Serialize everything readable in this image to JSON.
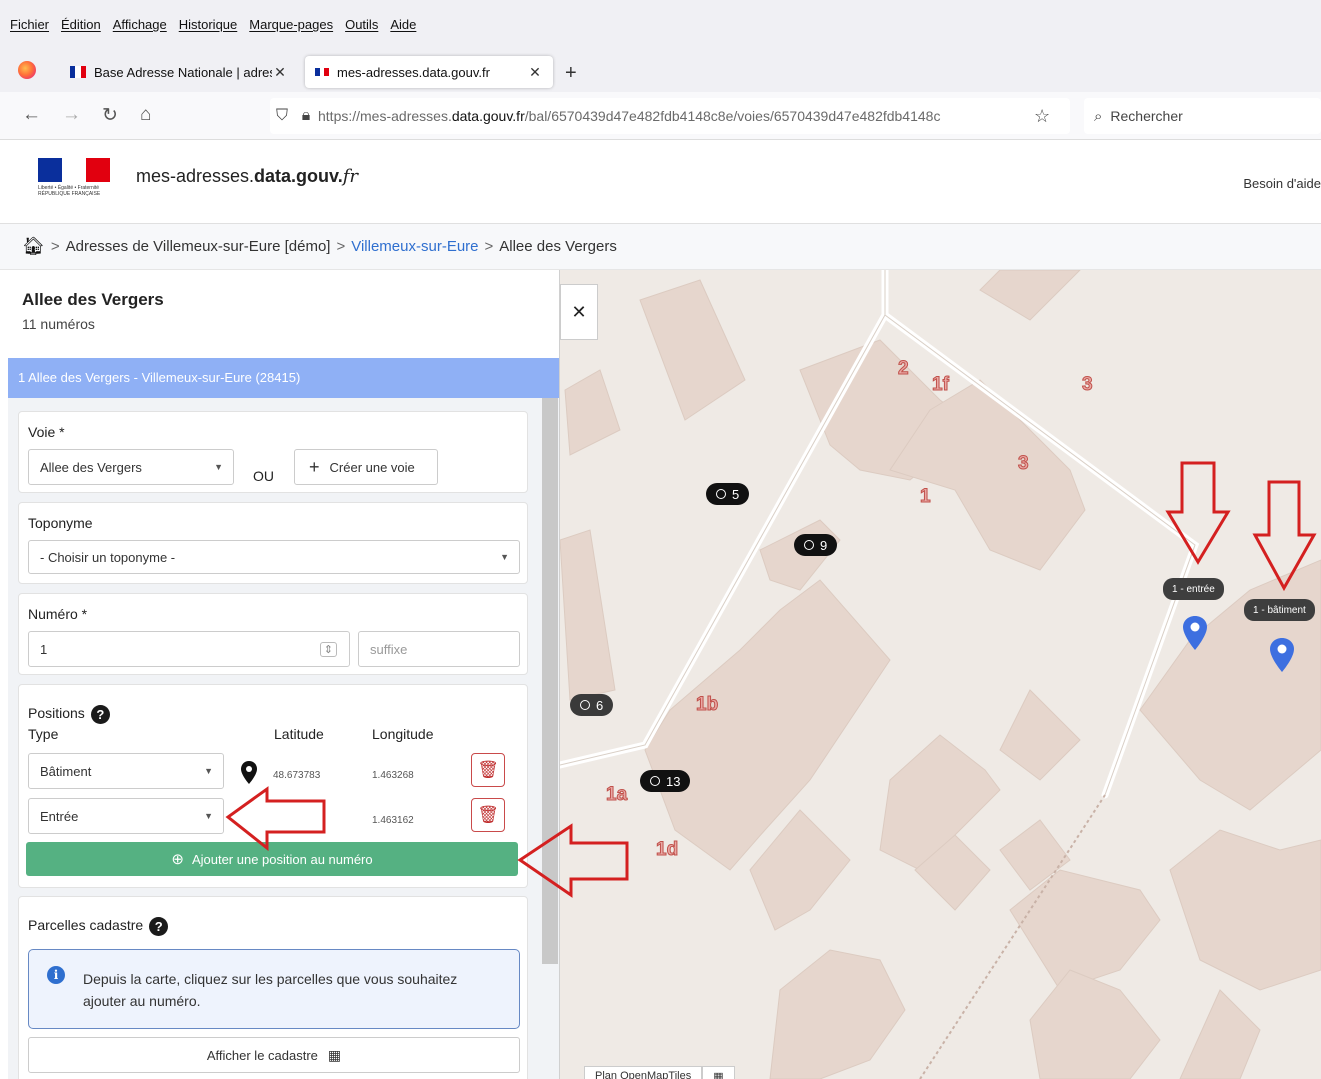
{
  "browser": {
    "menu": [
      "Fichier",
      "Édition",
      "Affichage",
      "Historique",
      "Marque-pages",
      "Outils",
      "Aide"
    ],
    "tabs": [
      {
        "label": "Base Adresse Nationale | adress"
      },
      {
        "label": "mes-adresses.data.gouv.fr"
      }
    ],
    "url_prefix": "https://mes-adresses.",
    "url_domain": "data.gouv.fr",
    "url_path": "/bal/6570439d47e482fdb4148c8e/voies/6570439d47e482fdb4148c",
    "search_placeholder": "Rechercher"
  },
  "site": {
    "logo_text": "Liberté • Égalité • Fraternité RÉPUBLIQUE FRANÇAISE",
    "name_prefix": "mes-adresses.",
    "name_bold": "data.gouv.",
    "name_suffix": "fr",
    "help": "Besoin d'aide"
  },
  "breadcrumb": {
    "items": [
      "Adresses de Villemeux-sur-Eure [démo]",
      "Villemeux-sur-Eure",
      "Allee des Vergers"
    ],
    "sep": ">"
  },
  "panel": {
    "title": "Allee des Vergers",
    "count": "11 numéros",
    "selected": "1 Allee des Vergers - Villemeux-sur-Eure (28415)",
    "voie_label": "Voie *",
    "voie_value": "Allee des Vergers",
    "ou": "OU",
    "create_voie": "Créer une voie",
    "toponyme_label": "Toponyme",
    "toponyme_value": "- Choisir un toponyme -",
    "numero_label": "Numéro *",
    "numero_value": "1",
    "suffixe_placeholder": "suffixe",
    "positions_label": "Positions",
    "col_type": "Type",
    "col_lat": "Latitude",
    "col_lon": "Longitude",
    "positions": [
      {
        "type": "Bâtiment",
        "lat": "48.673783",
        "lon": "1.463268"
      },
      {
        "type": "Entrée",
        "lat": "",
        "lon": "1.463162"
      }
    ],
    "add_position": "Ajouter une position au numéro",
    "cadastre_label": "Parcelles cadastre",
    "cadastre_info": "Depuis la carte, cliquez sur les parcelles que vous souhaitez ajouter au numéro.",
    "show_cadastre": "Afficher le cadastre"
  },
  "map": {
    "pills": [
      {
        "text": "5",
        "style": "black"
      },
      {
        "text": "9",
        "style": "black"
      },
      {
        "text": "6",
        "style": "grey"
      },
      {
        "text": "13",
        "style": "black"
      }
    ],
    "tooltips": [
      "1 - entrée",
      "1 - bâtiment"
    ],
    "labels": [
      "2",
      "1f",
      "3",
      "3",
      "1",
      "1b",
      "1a",
      "1d"
    ],
    "layer_btn": "Plan OpenMapTiles",
    "colors": {
      "pin": "#3d6fe0",
      "arrow": "#d42020",
      "building": "#e6d6cd",
      "road": "#ffffff"
    }
  }
}
